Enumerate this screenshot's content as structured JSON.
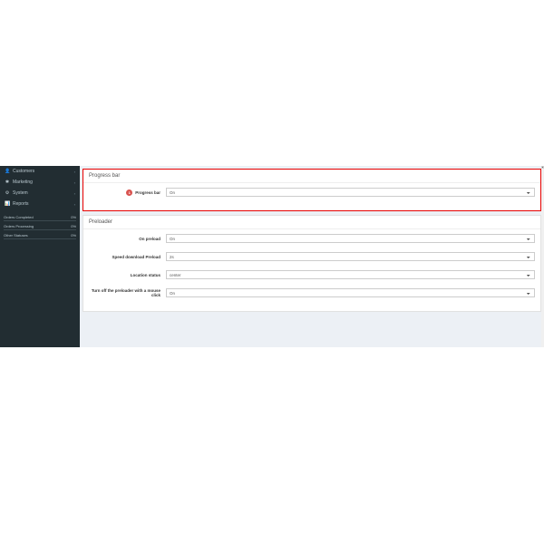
{
  "sidebar": {
    "items": [
      {
        "icon": "👤",
        "label": "Customers"
      },
      {
        "icon": "✱",
        "label": "Marketing"
      },
      {
        "icon": "⚙",
        "label": "System"
      },
      {
        "icon": "📊",
        "label": "Reports"
      }
    ],
    "stats": [
      {
        "label": "Orders Completed",
        "value": "0%",
        "fill": 0
      },
      {
        "label": "Orders Processing",
        "value": "0%",
        "fill": 0
      },
      {
        "label": "Other Statuses",
        "value": "0%",
        "fill": 0
      }
    ]
  },
  "sections": {
    "progress": {
      "title": "Progress bar",
      "marker": "1",
      "field_label": "Progress bar",
      "value": "On"
    },
    "preloader": {
      "title": "Preloader",
      "fields": [
        {
          "label": "On preload",
          "value": "On"
        },
        {
          "label": "Speed download Preload",
          "value": "2s"
        },
        {
          "label": "Location status",
          "value": "center"
        },
        {
          "label": "Turn off the preloader with a mouse click",
          "value": "On"
        }
      ]
    }
  }
}
